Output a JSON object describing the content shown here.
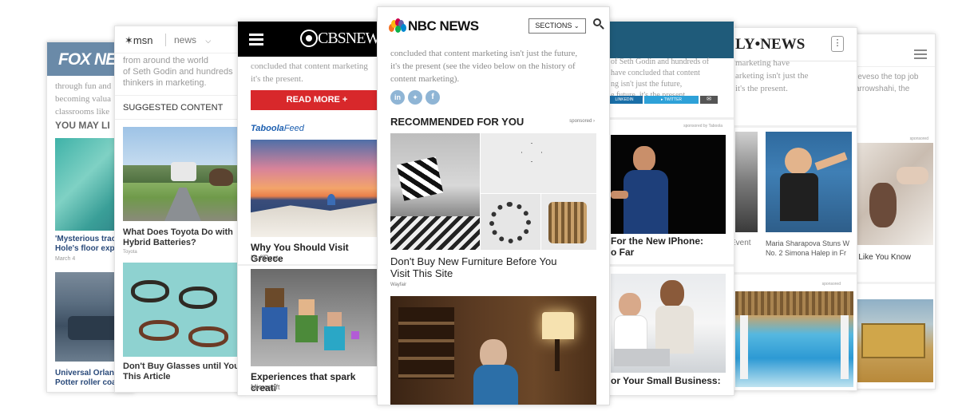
{
  "fox": {
    "logo": "FOX NE",
    "body_lines": [
      "through fun and",
      "becoming valua",
      "classrooms like"
    ],
    "section": "YOU MAY LI",
    "story1": {
      "title": [
        "'Mysterious trac",
        "Hole's floor exp"
      ],
      "date": "March 4"
    },
    "story2": {
      "title": [
        "Universal Orlan",
        "Potter roller coa"
      ]
    }
  },
  "msn": {
    "logo": "msn",
    "section_label": "news",
    "body_lines": [
      "from around the world",
      "of Seth Godin and hundreds",
      "thinkers in marketing."
    ],
    "suggested": "SUGGESTED CONTENT",
    "story1": {
      "title": [
        "What Does Toyota Do with",
        "Hybrid Batteries?"
      ],
      "source": "Toyota"
    },
    "story2": {
      "title": [
        "Don't Buy Glasses until You",
        "This Article"
      ]
    }
  },
  "cbs": {
    "logo": "CBSNEW",
    "body_lines": [
      "concluded that content marketing",
      "it's the present."
    ],
    "read_more": "READ MORE +",
    "feed_brand": "Taboola",
    "feed_label": "Feed",
    "story1": {
      "title": "Why You Should Visit Greece",
      "source": "HuffPost"
    },
    "story2": {
      "title": "Experiences that spark creati",
      "source": "Microsoft"
    }
  },
  "nbc": {
    "logo": "NBC NEWS",
    "sections_label": "SECTIONS",
    "body_lines": [
      "concluded that content marketing isn't just the future,",
      "it's the present (see the video below on the history of",
      "content marketing)."
    ],
    "recommended": "RECOMMENDED FOR YOU",
    "sponsored": "sponsored",
    "story1": {
      "title": [
        "Don't Buy New Furniture Before You",
        "Visit This Site"
      ],
      "source": "Wayfair"
    }
  },
  "bluecard": {
    "body_lines": [
      "of Seth Godin and hundreds of",
      "have concluded that content",
      "ng isn't just the future,",
      "e future, it's the present"
    ],
    "share_linkedin": "LINKEDIN",
    "share_twitter": "TWITTER",
    "sponsored": "sponsored by Taboola",
    "story1": {
      "title": [
        "For the New IPhone:",
        "o Far"
      ]
    },
    "story2": {
      "title": [
        "or Your Small Business:"
      ]
    }
  },
  "daily": {
    "logo": "LY•NEWS",
    "body_lines": [
      "marketing have",
      "arketing isn't just the",
      "it's the present."
    ],
    "story1": {
      "left_caption": "Event",
      "title": [
        "Maria Sharapova Stuns W",
        "No. 2 Simona Halep in Fr"
      ]
    },
    "sponsored": "sponsored"
  },
  "farright": {
    "body_lines": [
      "reveso the top job",
      "arrowshahi, the"
    ],
    "story1": {
      "title": [
        "n Like You Know"
      ]
    },
    "sponsored": "sponsored"
  }
}
